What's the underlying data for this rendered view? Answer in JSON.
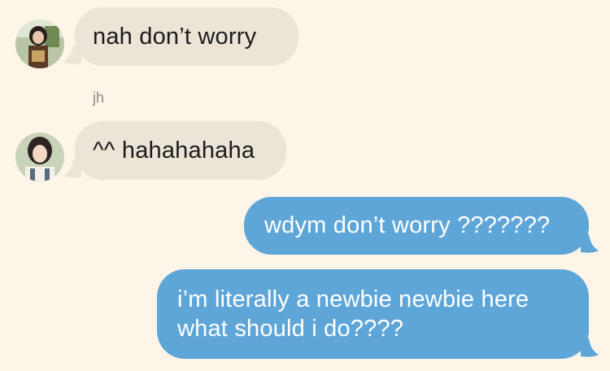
{
  "messages": [
    {
      "direction": "incoming",
      "text": "nah don’t worry",
      "avatar": "avatar-photo-1"
    },
    {
      "sender": "jh",
      "direction": "incoming",
      "text": "^^ hahahahaha",
      "avatar": "avatar-photo-2"
    },
    {
      "direction": "outgoing",
      "text": "wdym don’t worry ???????"
    },
    {
      "direction": "outgoing",
      "lines": [
        "i’m literally a newbie newbie here",
        "what should i do????"
      ]
    }
  ],
  "colors": {
    "background": "#fdf5e8",
    "incoming_bubble": "#ece4d6",
    "outgoing_bubble": "#5fa6d8",
    "incoming_text": "#1c1c1c",
    "outgoing_text": "#ffffff",
    "sender_label": "#8b8b8b"
  }
}
